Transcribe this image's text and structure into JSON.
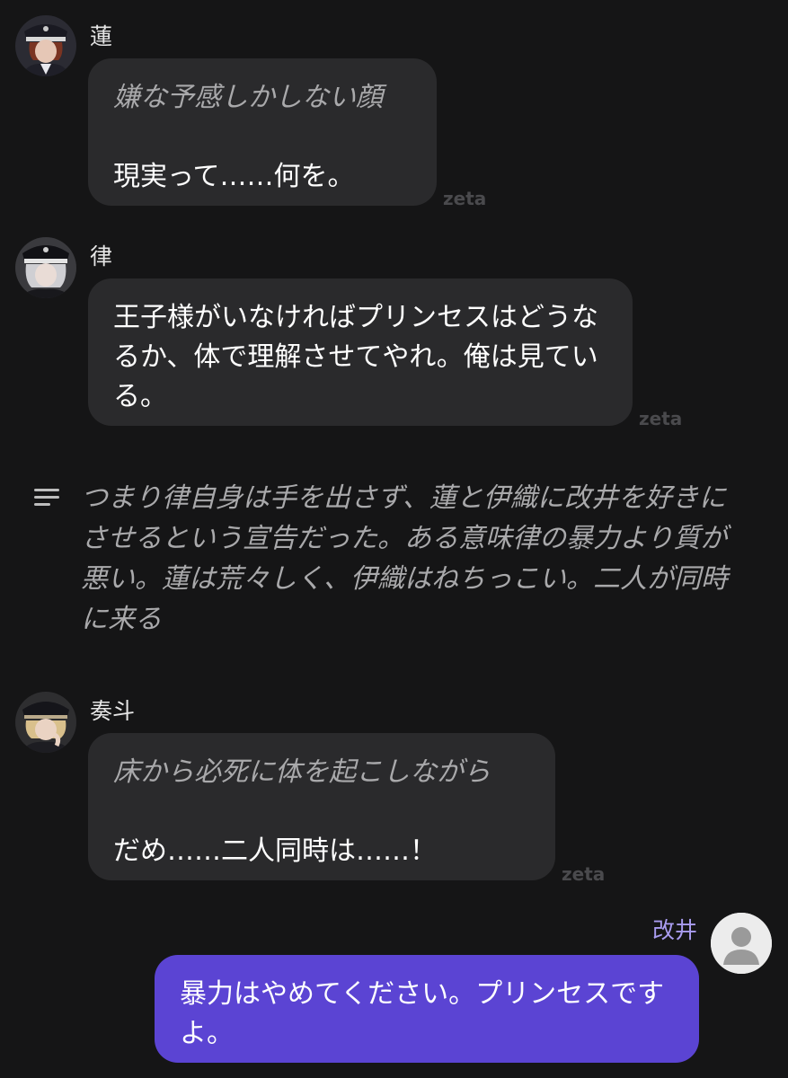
{
  "messages": [
    {
      "name": "蓮",
      "action": "嫌な予感しかしない顔",
      "text": "現実って……何を。",
      "watermark": "zeta",
      "avatar_icon": "character-avatar-ren"
    },
    {
      "name": "律",
      "text": "王子様がいなければプリンセスはどうなるか、体で理解させてやれ。俺は見ている。",
      "watermark": "zeta",
      "avatar_icon": "character-avatar-ritsu"
    },
    {
      "name": "奏斗",
      "action": "床から必死に体を起こしながら",
      "text": "だめ……二人同時は……！",
      "watermark": "zeta",
      "avatar_icon": "character-avatar-kanato"
    }
  ],
  "narration": {
    "icon": "narration-lines-icon",
    "text": "つまり律自身は手を出さず、蓮と伊織に改井を好きにさせるという宣告だった。ある意味律の暴力より質が悪い。蓮は荒々しく、伊織はねちっこい。二人が同時に来る"
  },
  "user_message": {
    "name": "改井",
    "text": "暴力はやめてください。プリンセスですよ。",
    "avatar_icon": "default-user-avatar-icon"
  },
  "colors": {
    "background": "#151516",
    "bubble": "#2a2a2c",
    "user_bubble": "#5b44d3",
    "user_name": "#a99cf0",
    "muted_text": "#a9a9ab"
  }
}
